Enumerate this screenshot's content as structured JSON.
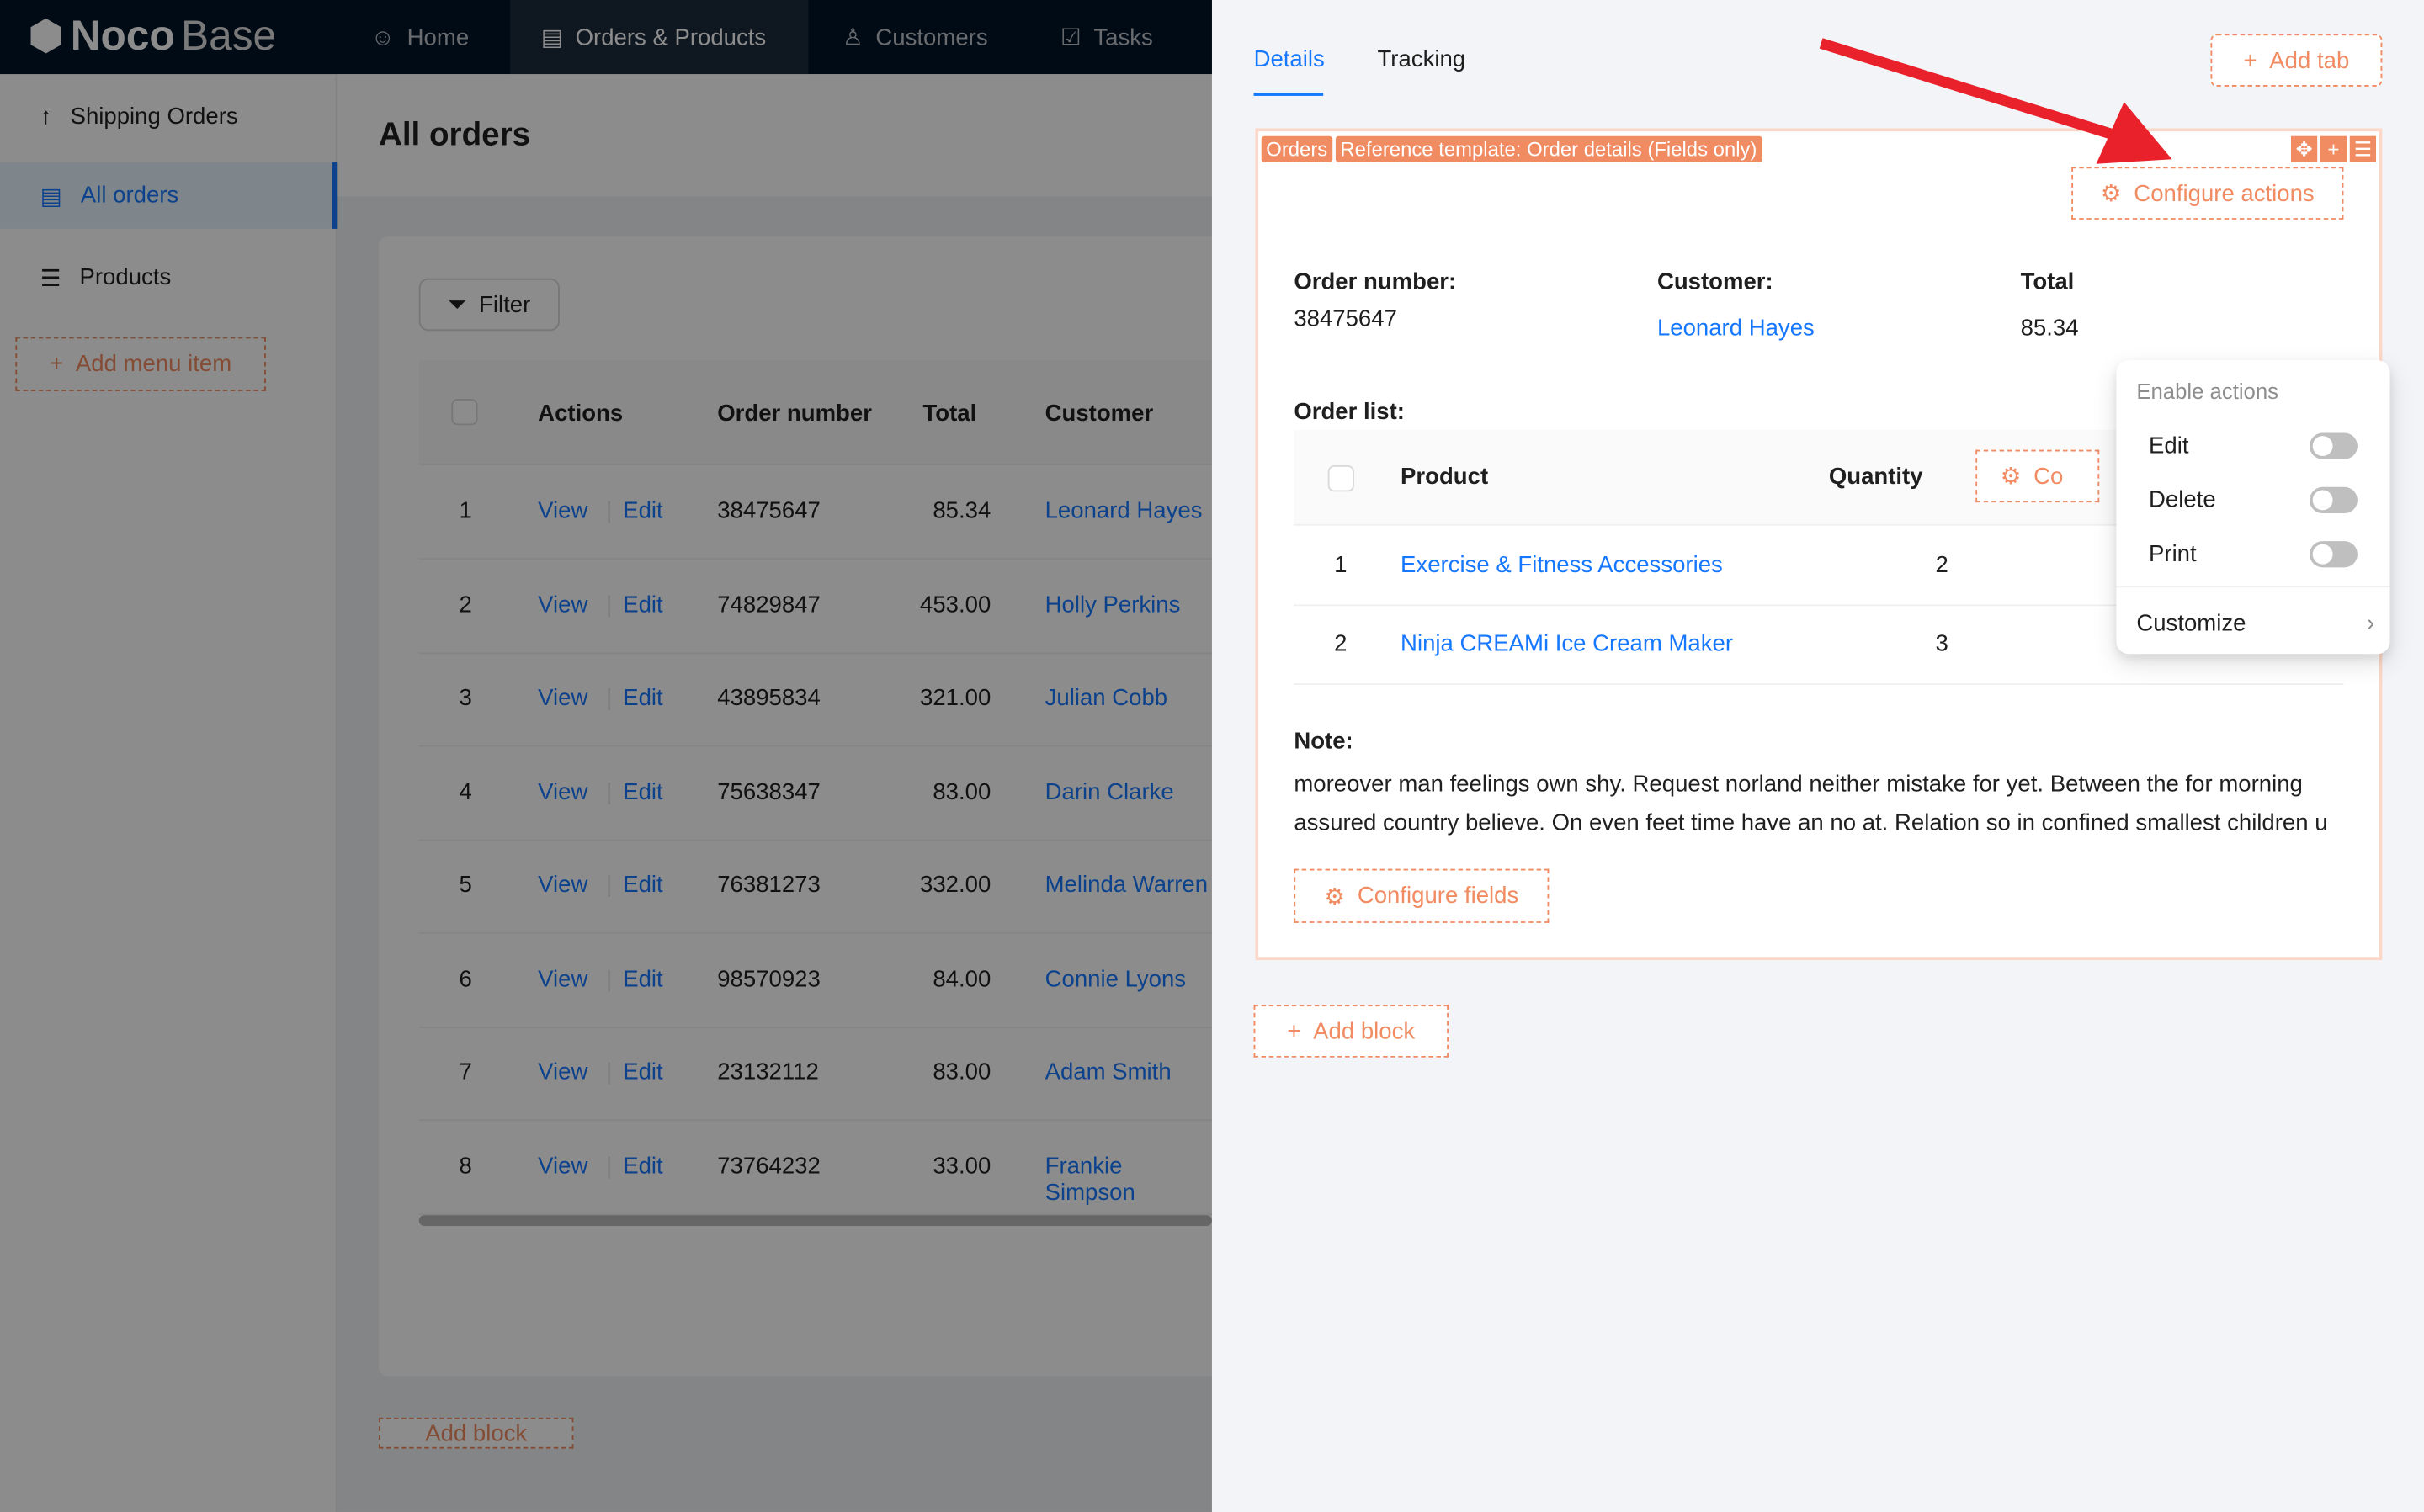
{
  "app": {
    "logo": "NocoBase",
    "logo_bold": "Noco",
    "logo_light": "Base"
  },
  "topnav": [
    {
      "label": "Home",
      "icon": "smile-icon"
    },
    {
      "label": "Orders & Products",
      "icon": "file-check-icon",
      "selected": true
    },
    {
      "label": "Customers",
      "icon": "users-icon"
    },
    {
      "label": "Tasks",
      "icon": "checkbox-icon"
    }
  ],
  "sidebar": {
    "items": [
      {
        "label": "Shipping Orders",
        "icon": "arrow-up-icon"
      },
      {
        "label": "All orders",
        "icon": "file-check-icon",
        "selected": true
      },
      {
        "label": "Products",
        "icon": "list-icon"
      }
    ],
    "add_menu_item": "Add menu item"
  },
  "page": {
    "title": "All orders",
    "filter": "Filter",
    "add_block": "Add block",
    "columns": [
      "Actions",
      "Order number",
      "Total",
      "Customer"
    ],
    "rows": [
      {
        "n": "1",
        "view": "View",
        "edit": "Edit",
        "order": "38475647",
        "total": "85.34",
        "customer": "Leonard Hayes"
      },
      {
        "n": "2",
        "view": "View",
        "edit": "Edit",
        "order": "74829847",
        "total": "453.00",
        "customer": "Holly Perkins"
      },
      {
        "n": "3",
        "view": "View",
        "edit": "Edit",
        "order": "43895834",
        "total": "321.00",
        "customer": "Julian Cobb"
      },
      {
        "n": "4",
        "view": "View",
        "edit": "Edit",
        "order": "75638347",
        "total": "83.00",
        "customer": "Darin Clarke"
      },
      {
        "n": "5",
        "view": "View",
        "edit": "Edit",
        "order": "76381273",
        "total": "332.00",
        "customer": "Melinda Warren"
      },
      {
        "n": "6",
        "view": "View",
        "edit": "Edit",
        "order": "98570923",
        "total": "84.00",
        "customer": "Connie Lyons"
      },
      {
        "n": "7",
        "view": "View",
        "edit": "Edit",
        "order": "23132112",
        "total": "83.00",
        "customer": "Adam Smith"
      },
      {
        "n": "8",
        "view": "View",
        "edit": "Edit",
        "order": "73764232",
        "total": "33.00",
        "customer": "Frankie Simpson"
      }
    ]
  },
  "drawer": {
    "tabs": [
      {
        "label": "Details",
        "active": true
      },
      {
        "label": "Tracking"
      }
    ],
    "add_tab": "Add tab",
    "block": {
      "tag_collection": "Orders",
      "tag_template": "Reference template: Order details (Fields only)",
      "configure_actions": "Configure actions",
      "fields": {
        "order_number_label": "Order number:",
        "order_number": "38475647",
        "customer_label": "Customer:",
        "customer": "Leonard Hayes",
        "total_label": "Total",
        "total": "85.34"
      },
      "order_list_label": "Order list:",
      "order_columns": [
        "Product",
        "Quantity"
      ],
      "order_config_partial": "Co",
      "order_rows": [
        {
          "n": "1",
          "product": "Exercise & Fitness Accessories",
          "qty": "2"
        },
        {
          "n": "2",
          "product": "Ninja CREAMi Ice Cream Maker",
          "qty": "3"
        }
      ],
      "note_label": "Note:",
      "note_line1": "moreover man feelings own shy. Request norland neither mistake for yet. Between the for morning",
      "note_line2": "assured country believe. On even feet time have an no at. Relation so in confined smallest children u",
      "configure_fields": "Configure fields"
    },
    "add_block": "Add block",
    "dropdown": {
      "header": "Enable actions",
      "items": [
        {
          "label": "Edit",
          "enabled": false
        },
        {
          "label": "Delete",
          "enabled": false
        },
        {
          "label": "Print",
          "enabled": false
        }
      ],
      "customize": "Customize"
    }
  },
  "colors": {
    "primary": "#1677ff",
    "design": "#f18b62",
    "annotation_arrow": "#e8212b",
    "header": "#001529"
  }
}
